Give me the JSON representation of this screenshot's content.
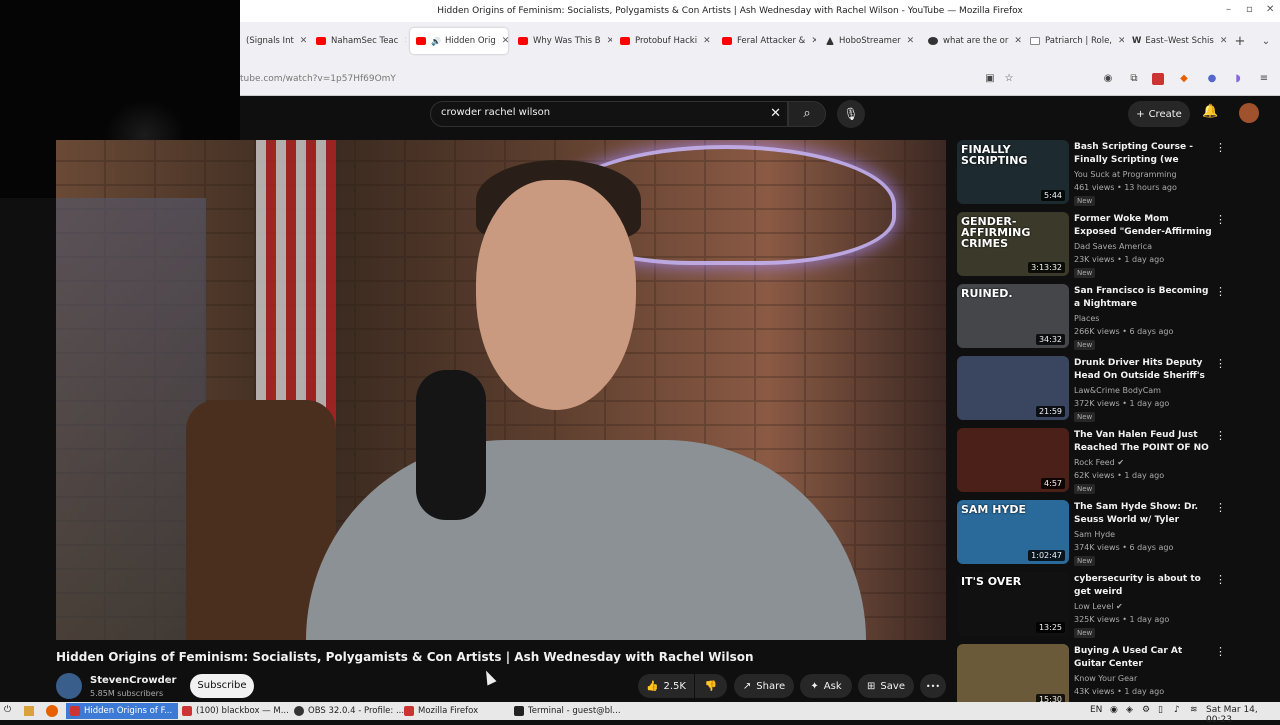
{
  "window": {
    "title": "Hidden Origins of Feminism: Socialists, Polygamists & Con Artists | Ash Wednesday with Rachel Wilson - YouTube — Mozilla Firefox",
    "min": "–",
    "max": "▫",
    "close": "✕"
  },
  "tabs": [
    {
      "label": "(Signals Int",
      "close": "✕"
    },
    {
      "label": "NahamSec Teac",
      "close": "✕"
    },
    {
      "label": "Hidden Orig",
      "close": "✕"
    },
    {
      "label": "Why Was This B",
      "close": "✕"
    },
    {
      "label": "Protobuf Hacki",
      "close": "✕"
    },
    {
      "label": "Feral Attacker &",
      "close": "✕"
    },
    {
      "label": "HoboStreamer",
      "close": "✕"
    },
    {
      "label": "what are the or",
      "close": "✕"
    },
    {
      "label": "Patriarch | Role,",
      "close": "✕"
    },
    {
      "label": "East–West Schis",
      "close": "✕"
    }
  ],
  "new_tab": "+",
  "tab_list": "⌄",
  "address": {
    "url": "tube.com/watch?v=1p57Hf69OmY"
  },
  "toolbar_icons": {
    "reader": "▣",
    "bookmark": "☆",
    "account": "◉",
    "extensions": "⧉",
    "menu": "≡"
  },
  "search": {
    "value": "crowder rachel wilson",
    "clear": "✕",
    "button": "⌕",
    "mic": "🎙"
  },
  "header": {
    "create_label": "Create",
    "create_plus": "+",
    "bell": "🔔"
  },
  "video": {
    "title": "Hidden Origins of Feminism: Socialists, Polygamists & Con Artists | Ash Wednesday with Rachel Wilson",
    "channel": "StevenCrowder",
    "verified": "✔",
    "subscribers": "5.85M subscribers",
    "subscribe_label": "Subscribe",
    "likes": "2.5K",
    "like_icon": "👍",
    "dislike_icon": "👎",
    "share_icon": "↗",
    "share_label": "Share",
    "ask_icon": "✦",
    "ask_label": "Ask",
    "save_icon": "⊞",
    "save_label": "Save",
    "more_icon": "•••"
  },
  "recommendations": [
    {
      "title": "Bash Scripting Course - Finally Scripting (we actually make a ...",
      "channel": "You Suck at Programming",
      "meta": "461 views • 13 hours ago",
      "badge": "New",
      "duration": "5:44",
      "overlay": "FINALLY SCRIPTING",
      "thumb": "#1d2a2f",
      "verified": ""
    },
    {
      "title": "Former Woke Mom Exposed \"Gender-Affirming Care\" Fraud",
      "channel": "Dad Saves America",
      "meta": "23K views • 1 day ago",
      "badge": "New",
      "duration": "3:13:32",
      "overlay": "GENDER-AFFIRMING CRIMES",
      "thumb": "#3b3a2a",
      "verified": ""
    },
    {
      "title": "San Francisco is Becoming a Nightmare",
      "channel": "Places",
      "meta": "266K views • 6 days ago",
      "badge": "New",
      "duration": "34:32",
      "overlay": "RUINED.",
      "thumb": "#44464a",
      "verified": ""
    },
    {
      "title": "Drunk Driver Hits Deputy Head On Outside Sheriff's Office",
      "channel": "Law&Crime BodyCam",
      "meta": "372K views • 1 day ago",
      "badge": "New",
      "duration": "21:59",
      "overlay": "",
      "thumb": "#3a4660",
      "verified": ""
    },
    {
      "title": "The Van Halen Feud Just Reached The POINT OF NO ...",
      "channel": "Rock Feed",
      "meta": "62K views • 1 day ago",
      "badge": "New",
      "duration": "4:57",
      "overlay": "",
      "thumb": "#4a2018",
      "verified": "✔"
    },
    {
      "title": "The Sam Hyde Show: Dr. Seuss World w/ Tyler Oliveira",
      "channel": "Sam Hyde",
      "meta": "374K views • 6 days ago",
      "badge": "New",
      "duration": "1:02:47",
      "overlay": "SAM HYDE",
      "thumb": "#2a6a9a",
      "verified": ""
    },
    {
      "title": "cybersecurity is about to get weird",
      "channel": "Low Level",
      "meta": "325K views • 1 day ago",
      "badge": "New",
      "duration": "13:25",
      "overlay": "IT'S OVER",
      "thumb": "#111111",
      "verified": "✔"
    },
    {
      "title": "Buying A Used Car At Guitar Center",
      "channel": "Know Your Gear",
      "meta": "43K views • 1 day ago",
      "badge": "",
      "duration": "15:30",
      "overlay": "",
      "thumb": "#6a5a3a",
      "verified": ""
    }
  ],
  "rec_menu": "⋮",
  "taskbar": {
    "items": [
      "Hidden Origins of F...",
      "(100) blackbox — M...",
      "OBS 32.0.4 - Profile: ...",
      "Mozilla Firefox",
      "Terminal - guest@bl..."
    ],
    "lang": "EN",
    "clock": "Sat Mar 14, 00:23"
  }
}
